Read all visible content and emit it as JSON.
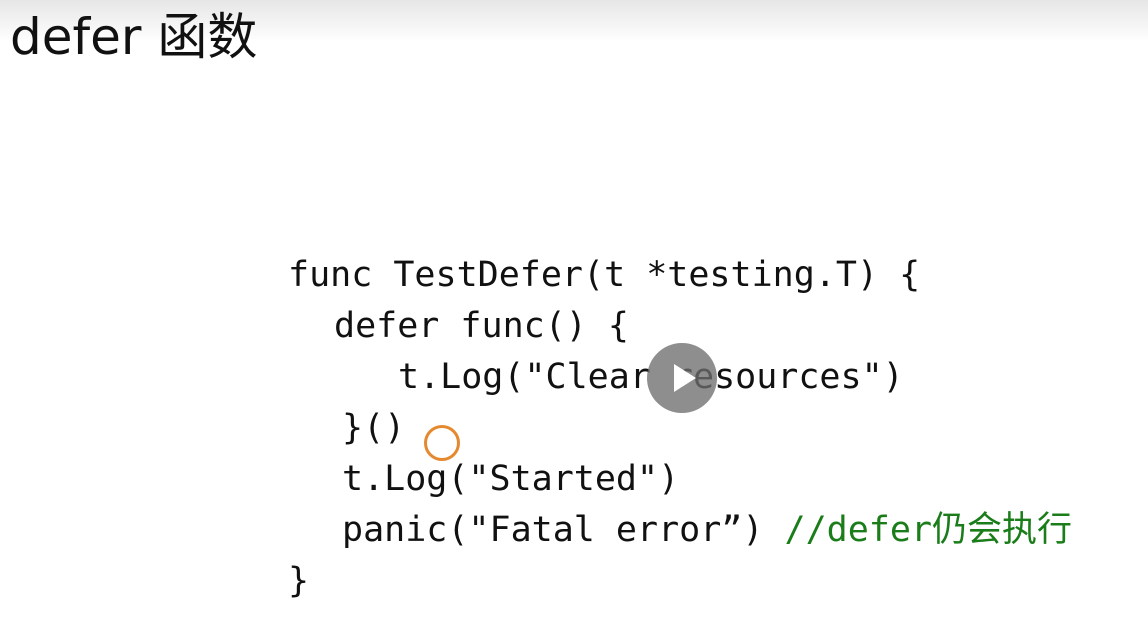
{
  "slide": {
    "title": "defer 函数"
  },
  "code": {
    "lines": [
      "func TestDefer(t *testing.T) {",
      "defer func() {",
      "t.Log(\"Clear resources\")",
      "}()",
      "t.Log(\"Started\")",
      "panic(\"Fatal error”) ",
      "}"
    ],
    "comment": "//defer仍会执行"
  },
  "player": {
    "play_icon": "play-icon"
  },
  "colors": {
    "text": "#111111",
    "comment": "#1a7d1a",
    "cursor_ring": "#e5892e",
    "play_overlay": "#6e6e6e"
  }
}
